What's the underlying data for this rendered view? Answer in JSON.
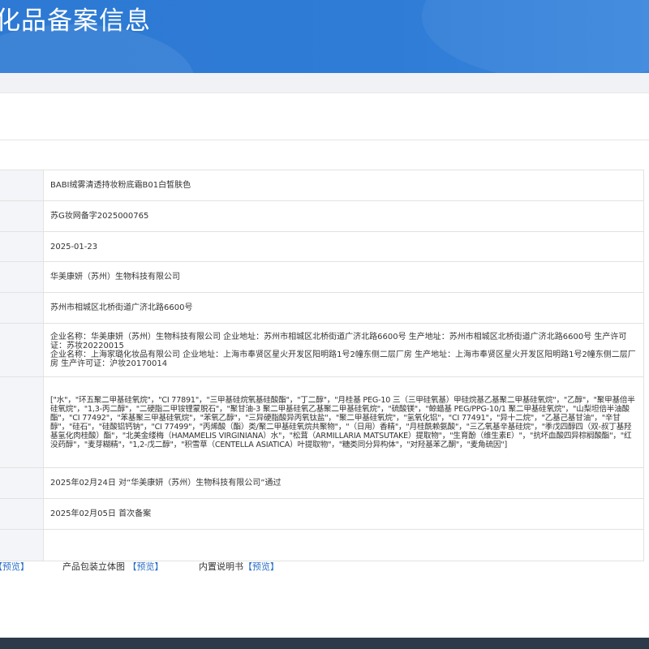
{
  "header": {
    "title": "化品备案信息"
  },
  "rows": [
    {
      "value": "BABI绒雾清透持妆粉底霜B01白皙肤色"
    },
    {
      "value": "苏G妆网备字2025000765"
    },
    {
      "value": "2025-01-23"
    },
    {
      "value": "华美康妍（苏州）生物科技有限公司"
    },
    {
      "value": "苏州市相城区北桥街道广济北路6600号"
    },
    {
      "lines": [
        "企业名称：华美康妍（苏州）生物科技有限公司 企业地址：苏州市相城区北桥街道广济北路6600号 生产地址：苏州市相城区北桥街道广济北路6600号 生产许可证：苏妆20220015",
        "企业名称：上海家璐化妆品有限公司 企业地址：上海市奉贤区星火开发区阳明路1号2幢东侧二层厂房 生产地址：上海市奉贤区星火开发区阳明路1号2幢东侧二层厂房 生产许可证：沪妆20170014"
      ]
    },
    {
      "value": "[\"水\"，\"环五聚二甲基硅氧烷\"，\"CI 77891\"，\"三甲基硅烷氧基硅酸酯\"，\"丁二醇\"，\"月桂基 PEG-10 三（三甲硅氧基）甲硅烷基乙基聚二甲基硅氧烷\"，\"乙醇\"，\"聚甲基倍半硅氧烷\"，\"1,3-丙二醇\"，\"二硬脂二甲铵锂蒙脱石\"，\"聚甘油-3 聚二甲基硅氧乙基聚二甲基硅氧烷\"，\"硫酸镁\"，\"鲸蜡基 PEG/PPG-10/1 聚二甲基硅氧烷\"，\"山梨坦倍半油酸酯\"，\"CI 77492\"，\"苯基聚三甲基硅氧烷\"，\"苯氧乙醇\"，\"三异硬脂酸异丙氧钛盐\"，\"聚二甲基硅氧烷\"，\"氢氧化铝\"，\"CI 77491\"，\"异十二烷\"，\"乙基己基甘油\"，\"辛甘醇\"，\"硅石\"，\"硅酸铝钙钠\"，\"CI 77499\"，\"丙烯酸（酯）类/聚二甲基硅氧烷共聚物\"，\"（日用）香精\"，\"月桂酰赖氨酸\"，\"三乙氧基辛基硅烷\"，\"季戊四醇四（双-叔丁基羟基氢化肉桂酸）酯\"，\"北美金缕梅（HAMAMELIS VIRGINIANA）水\"，\"松茸（ARMILLARIA MATSUTAKE）提取物\"，\"生育酚（维生素E）\"，\"抗坏血酸四异棕榈酸酯\"，\"红没药醇\"，\"麦芽糊精\"，\"1,2-戊二醇\"，\"积雪草（CENTELLA ASIATICA）叶提取物\"，\"糖类同分异构体\"，\"对羟基苯乙酮\"，\"麦角硫因\"]"
    },
    {
      "value": "2025年02月24日 对“华美康妍（苏州）生物科技有限公司”通过"
    },
    {
      "value": "2025年02月05日 首次备案"
    },
    {
      "value": ""
    }
  ],
  "previews": [
    {
      "label": "",
      "link": "【预览】"
    },
    {
      "label": "产品包装立体图",
      "link": "【预览】"
    },
    {
      "label": "内置说明书",
      "link": "【预览】"
    }
  ]
}
